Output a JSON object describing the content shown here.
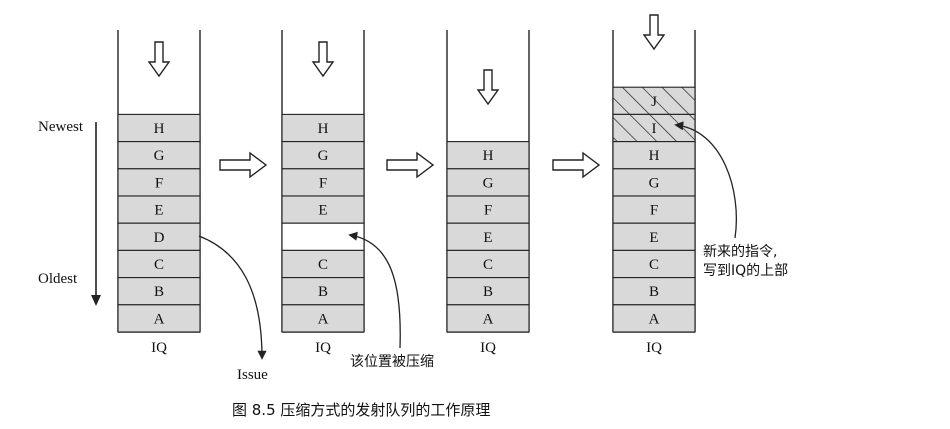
{
  "labels": {
    "newest": "Newest",
    "oldest": "Oldest",
    "issue": "Issue",
    "compressed_note": "该位置被压缩",
    "new_instr_line1": "新来的指令,",
    "new_instr_line2": "写到IQ的上部",
    "caption": "图 8.5    压缩方式的发射队列的工作原理"
  },
  "queues": [
    {
      "label": "IQ",
      "slots": [
        "H",
        "G",
        "F",
        "E",
        "D",
        "C",
        "B",
        "A"
      ]
    },
    {
      "label": "IQ",
      "slots": [
        "H",
        "G",
        "F",
        "E",
        "",
        "C",
        "B",
        "A"
      ]
    },
    {
      "label": "IQ",
      "slots": [
        "H",
        "G",
        "F",
        "E",
        "C",
        "B",
        "A"
      ]
    },
    {
      "label": "IQ",
      "slots": [
        "J",
        "I",
        "H",
        "G",
        "F",
        "E",
        "C",
        "B",
        "A"
      ],
      "new_slots": 2
    }
  ],
  "colors": {
    "slot_fill": "#d9d9d9",
    "empty_fill": "#ffffff",
    "stroke": "#222222"
  }
}
